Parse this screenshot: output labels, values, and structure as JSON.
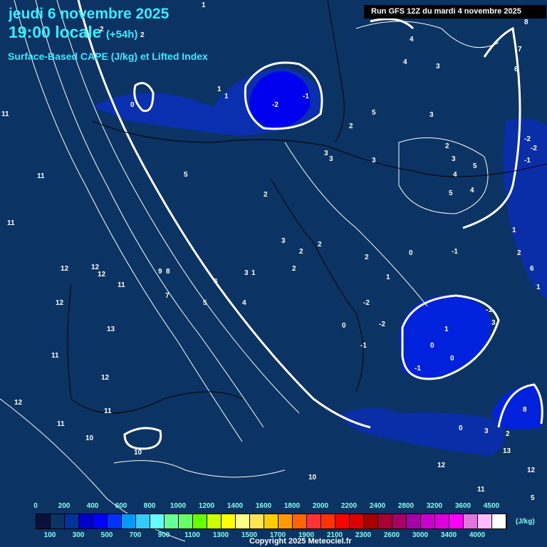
{
  "header": {
    "date": "jeudi 6 novembre 2025",
    "time": "19:00 locale",
    "lead": "(+54h)",
    "subtitle": "Surface-Based CAPE (J/kg) et Lifted Index",
    "run": "Run GFS 12Z du mardi 4 novembre 2025"
  },
  "li_labels": [
    "1",
    "2",
    "2",
    "0",
    "1",
    "1",
    "-1",
    "-2",
    "5",
    "4",
    "4",
    "3",
    "3",
    "8",
    "7",
    "6",
    "5",
    "2",
    "3",
    "3",
    "3",
    "2",
    "3",
    "4",
    "5",
    "4",
    "5",
    "-2",
    "-2",
    "-1",
    "11",
    "11",
    "11",
    "12",
    "12",
    "12",
    "11",
    "12",
    "13",
    "11",
    "12",
    "11",
    "12",
    "11",
    "10",
    "10",
    "9",
    "8",
    "7",
    "6",
    "5",
    "4",
    "3",
    "1",
    "2",
    "3",
    "2",
    "2",
    "2",
    "2",
    "1",
    "0",
    "0",
    "-2",
    "-1",
    "-2",
    "-1",
    "1",
    "0",
    "0",
    "-1",
    "-1",
    "3",
    "1",
    "2",
    "6",
    "1",
    "0",
    "3",
    "2",
    "8",
    "13",
    "12",
    "12",
    "11",
    "5",
    "10"
  ],
  "legend": {
    "colors": [
      "#08123a",
      "#0a3366",
      "#003399",
      "#0000cc",
      "#0000ff",
      "#0033ff",
      "#0099ff",
      "#33ccff",
      "#66ffff",
      "#66ff99",
      "#66ff66",
      "#66ff00",
      "#ccff00",
      "#ffff00",
      "#ffff88",
      "#ffe650",
      "#ffcc00",
      "#ff9900",
      "#ff6600",
      "#ff3333",
      "#ff3300",
      "#ff0000",
      "#dd0000",
      "#aa0000",
      "#aa0033",
      "#aa0066",
      "#aa00aa",
      "#cc00cc",
      "#dd00dd",
      "#ff00ff",
      "#dd77dd",
      "#ffbbff",
      "#ffffff"
    ],
    "top_labels": [
      "0",
      "200",
      "400",
      "600",
      "800",
      "1000",
      "1200",
      "1400",
      "1600",
      "1800",
      "2000",
      "2200",
      "2400",
      "2800",
      "3200",
      "3600",
      "4500"
    ],
    "bottom_labels": [
      "100",
      "300",
      "500",
      "700",
      "900",
      "1100",
      "1300",
      "1500",
      "1700",
      "1900",
      "2100",
      "2300",
      "2600",
      "3000",
      "3400",
      "4000"
    ],
    "unit": "(J/kg)"
  },
  "copyright": "Copyright 2025 Meteociel.fr"
}
